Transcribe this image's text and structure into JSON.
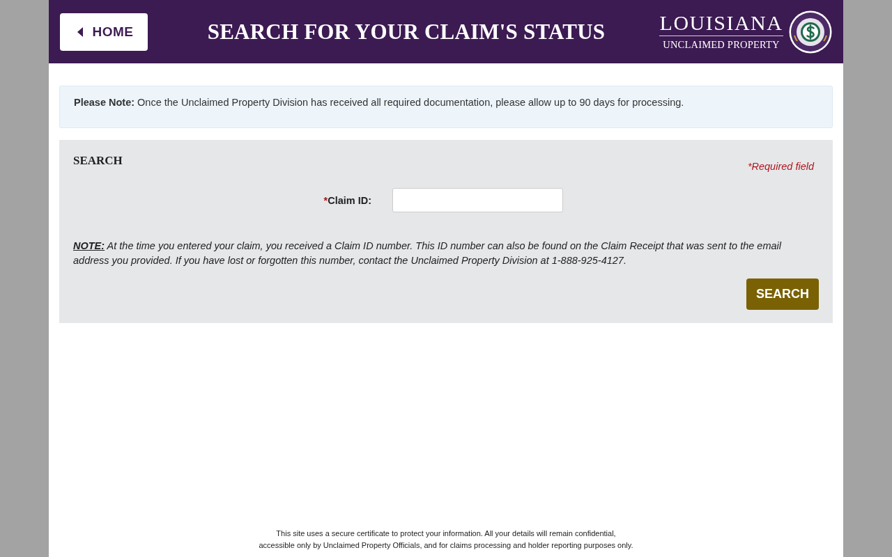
{
  "header": {
    "home_button": "HOME",
    "title": "SEARCH FOR YOUR CLAIM'S STATUS",
    "logo": {
      "title": "LOUISIANA",
      "subtitle": "UNCLAIMED PROPERTY"
    }
  },
  "notice": "**Please Note:** Once the Unclaimed Property Division has received all required documentation, please allow up to 90 days for processing.",
  "search_panel": {
    "heading": "SEARCH",
    "required_note": "*Required field",
    "fields": [
      {
        "marker": "*",
        "label": "Claim ID:"
      }
    ],
    "note_label": "NOTE:",
    "note_text": "At the time you entered your claim, you received a Claim ID number. This ID number can also be found on the Claim Receipt that was sent to the email address you provided. If you have lost or forgotten this number, contact the Unclaimed Property Division at 1-888-925-4127.",
    "search_button": "SEARCH"
  },
  "footer": {
    "lines": [
      "This site uses a secure certificate to protect your information. All your details will remain confidential,",
      "accessible only by Unclaimed Property Officials, and for claims processing and holder reporting purposes only."
    ]
  }
}
